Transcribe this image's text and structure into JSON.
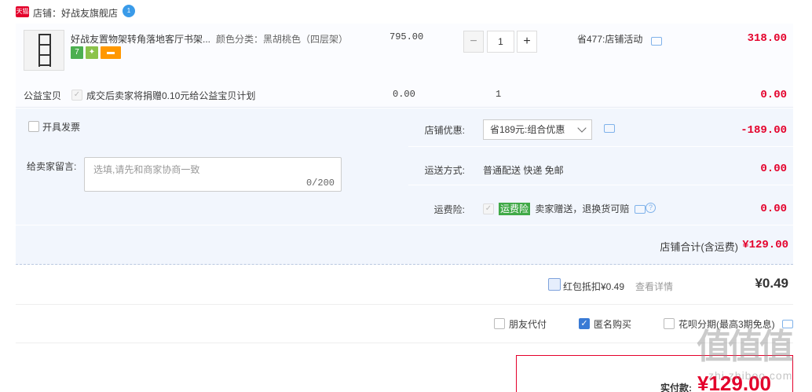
{
  "shop": {
    "badge": "天猫",
    "name": "店铺：好战友旗舰店",
    "ww_badge": "1"
  },
  "item": {
    "title": "好战友置物架转角落地客厅书架...",
    "sku": "颜色分类：黑胡桃色（四层架）",
    "badges": [
      {
        "text": "7",
        "color": "#4caf50"
      },
      {
        "text": "✦",
        "color": "#8bc34a"
      },
      {
        "text": "▬",
        "color": "#ff9800"
      }
    ],
    "unit_price": "795.00",
    "minus": "−",
    "plus": "+",
    "quantity": "1",
    "discount": "省477:店铺活动",
    "total": "318.00"
  },
  "charity": {
    "label": "公益宝贝",
    "text": "成交后卖家将捐赠0.10元给公益宝贝计划",
    "price": "0.00",
    "qty": "1",
    "total": "0.00"
  },
  "invoice": {
    "label": "开具发票"
  },
  "note": {
    "label": "给卖家留言:",
    "placeholder": "选填,请先和商家协商一致",
    "counter": "0/200"
  },
  "options": {
    "shop_discount_label": "店铺优惠:",
    "shop_discount_value": "省189元:组合优惠",
    "shop_discount_amount": "-189.00",
    "shipping_label": "运送方式:",
    "shipping_value": "普通配送 快递 免邮",
    "shipping_amount": "0.00",
    "insurance_label": "运费险:",
    "insurance_tag": "运费险",
    "insurance_text": "卖家赠送，退换货可赔",
    "insurance_amount": "0.00"
  },
  "shop_total": {
    "label": "店铺合计(含运费)",
    "amount": "¥129.00"
  },
  "red_packet": {
    "label": "红包抵扣¥0.49",
    "link": "查看详情",
    "amount": "¥0.49"
  },
  "extras": {
    "friend_pay": "朋友代付",
    "anonymous": "匿名购买",
    "huabei": "花呗分期(最高3期免息)"
  },
  "pay": {
    "label": "实付款:",
    "amount": "¥129.00"
  },
  "watermark": {
    "big": "值值值",
    "small": "zhi.zhiboo.com"
  }
}
